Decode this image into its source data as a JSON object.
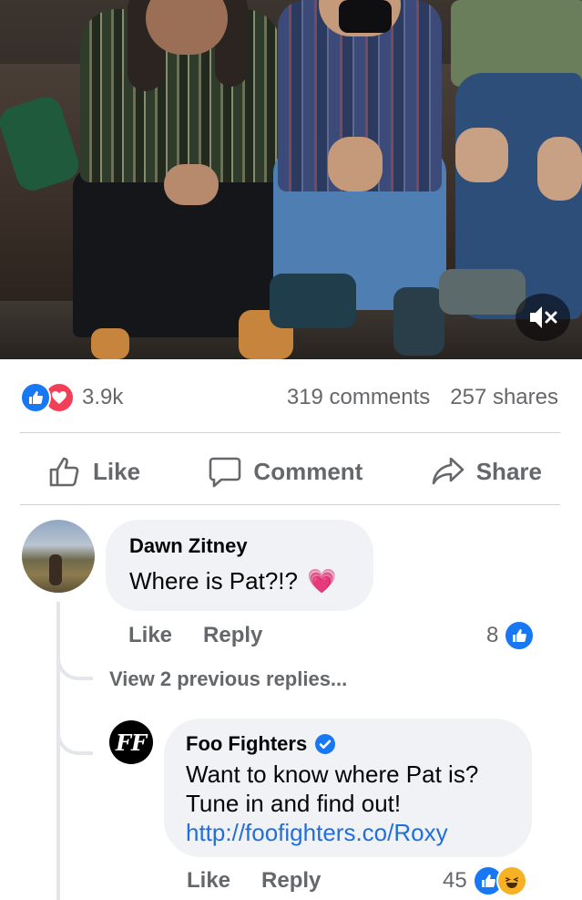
{
  "post": {
    "media": {
      "mute_icon": "speaker-mute-icon"
    },
    "stats": {
      "reactions_count": "3.9k",
      "comments": "319 comments",
      "shares": "257 shares"
    },
    "actions": {
      "like": "Like",
      "comment": "Comment",
      "share": "Share"
    }
  },
  "comments": {
    "first": {
      "author": "Dawn Zitney",
      "text": "Where is Pat?!?",
      "emoji": "💗",
      "like_label": "Like",
      "reply_label": "Reply",
      "like_count": "8"
    },
    "view_previous": "View 2 previous replies...",
    "reply": {
      "author": "Foo Fighters",
      "avatar_text": "FF",
      "line1": "Want to know where Pat is?",
      "line2": "Tune in and find out!",
      "link": "http://foofighters.co/Roxy",
      "like_label": "Like",
      "reply_label": "Reply",
      "like_count": "45"
    }
  },
  "colors": {
    "brand_blue": "#1877f2",
    "love_red": "#f33e58",
    "muted_text": "#65676b",
    "link_blue": "#216fdb"
  }
}
